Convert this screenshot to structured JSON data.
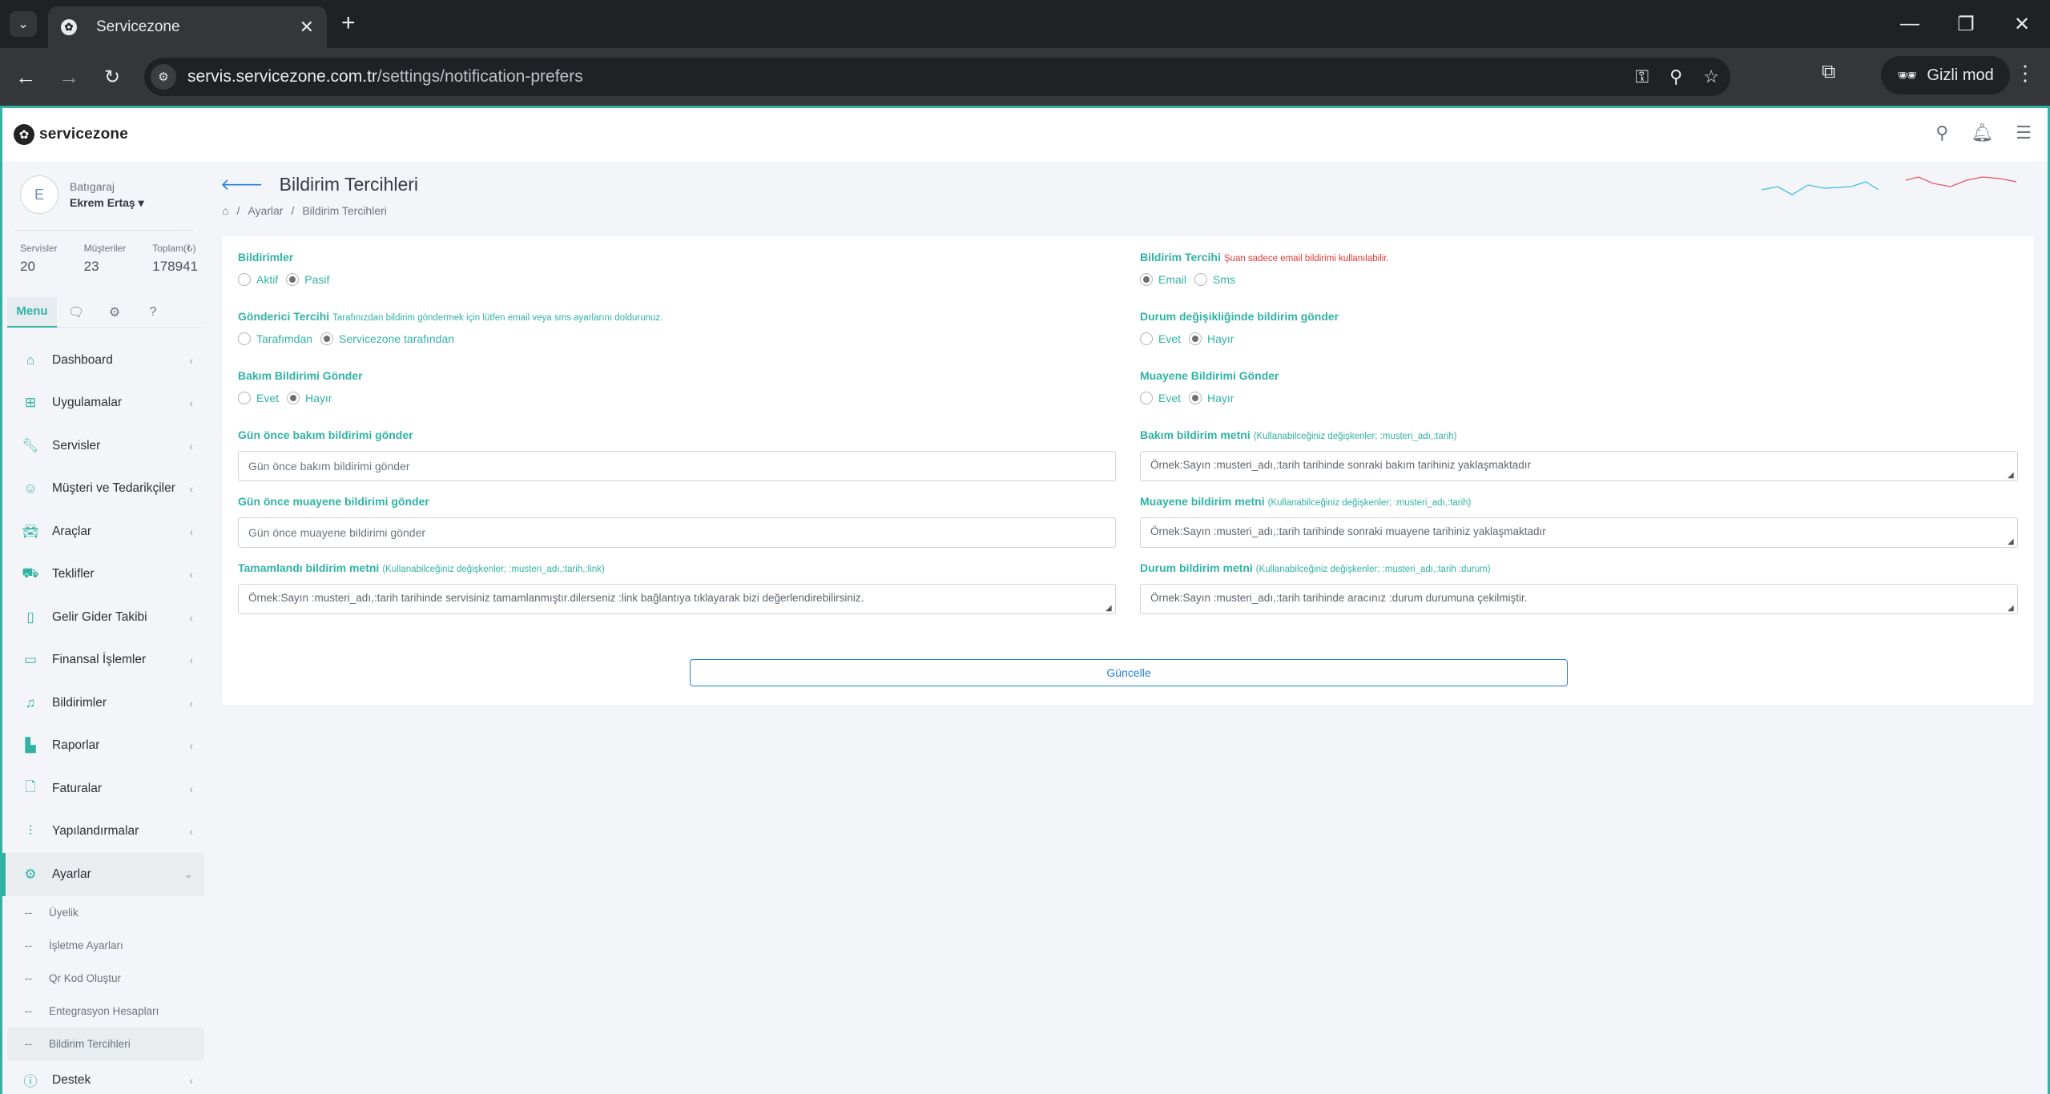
{
  "browser": {
    "tab_title": "Servicezone",
    "url_host": "servis.servicezone.com.tr",
    "url_path": "/settings/notification-prefers",
    "incognito_label": "Gizli mod"
  },
  "app": {
    "logo_text": "servicezone",
    "user": {
      "initial": "E",
      "company": "Batıgaraj",
      "name": "Ekrem Ertaş"
    },
    "stats": [
      {
        "label": "Servisler",
        "value": "20"
      },
      {
        "label": "Müşteriler",
        "value": "23"
      },
      {
        "label": "Toplam(₺)",
        "value": "178941"
      }
    ],
    "side_tab_menu": "Menu",
    "menu": [
      {
        "label": "Dashboard",
        "icon": "home-icon"
      },
      {
        "label": "Uygulamalar",
        "icon": "grid-icon"
      },
      {
        "label": "Servisler",
        "icon": "wrench-icon"
      },
      {
        "label": "Müşteri ve Tedarikçiler",
        "icon": "user-search-icon"
      },
      {
        "label": "Araçlar",
        "icon": "car-icon"
      },
      {
        "label": "Teklifler",
        "icon": "car-service-icon"
      },
      {
        "label": "Gelir Gider Takibi",
        "icon": "book-icon"
      },
      {
        "label": "Finansal İşlemler",
        "icon": "folder-icon"
      },
      {
        "label": "Bildirimler",
        "icon": "bell-icon"
      },
      {
        "label": "Raporlar",
        "icon": "bar-chart-icon"
      },
      {
        "label": "Faturalar",
        "icon": "file-icon"
      },
      {
        "label": "Yapılandırmalar",
        "icon": "sliders-icon"
      },
      {
        "label": "Ayarlar",
        "icon": "gear-icon"
      }
    ],
    "submenu": [
      {
        "label": "Üyelik"
      },
      {
        "label": "İşletme Ayarları"
      },
      {
        "label": "Qr Kod Oluştur"
      },
      {
        "label": "Entegrasyon Hesapları"
      },
      {
        "label": "Bildirim Tercihleri"
      }
    ],
    "menu_last": {
      "label": "Destek",
      "icon": "info-icon"
    },
    "submenu_dash": "--"
  },
  "page": {
    "title": "Bildirim Tercihleri",
    "breadcrumb": [
      "Ayarlar",
      "Bildirim Tercihleri"
    ],
    "breadcrumb_sep": "/"
  },
  "form": {
    "bildirimler": {
      "label": "Bildirimler",
      "options": [
        "Aktif",
        "Pasif"
      ],
      "selected": "Pasif"
    },
    "bildirim_tercihi": {
      "label": "Bildirim Tercihi",
      "note": "Şuan sadece email bildirimi kullanılabilir.",
      "options": [
        "Email",
        "Sms"
      ],
      "selected": "Email"
    },
    "gonderici_tercihi": {
      "label": "Gönderici Tercihi",
      "note": "Tarafınızdan bildirim göndermek için lütfen email veya sms ayarlarını doldurunuz.",
      "options": [
        "Tarafımdan",
        "Servicezone tarafından"
      ],
      "selected": "Servicezone tarafından"
    },
    "durum_degisikliginde": {
      "label": "Durum değişikliğinde bildirim gönder",
      "options": [
        "Evet",
        "Hayır"
      ],
      "selected": "Hayır"
    },
    "bakim_bildirimi": {
      "label": "Bakım Bildirimi Gönder",
      "options": [
        "Evet",
        "Hayır"
      ],
      "selected": "Hayır"
    },
    "muayene_bildirimi": {
      "label": "Muayene Bildirimi Gönder",
      "options": [
        "Evet",
        "Hayır"
      ],
      "selected": "Hayır"
    },
    "gun_once_bakim": {
      "label": "Gün önce bakım bildirimi gönder",
      "placeholder": "Gün önce bakım bildirimi gönder"
    },
    "bakim_metni": {
      "label": "Bakım bildirim metni",
      "note": "(Kullanabilceğiniz değişkenler; :musteri_adı,:tarih)",
      "placeholder": "Örnek:Sayın :musteri_adı,:tarih tarihinde sonraki bakım tarihiniz yaklaşmaktadır"
    },
    "gun_once_muayene": {
      "label": "Gün önce muayene bildirimi gönder",
      "placeholder": "Gün önce muayene bildirimi gönder"
    },
    "muayene_metni": {
      "label": "Muayene bildirim metni",
      "note": "(Kullanabilceğiniz değişkenler; :musteri_adı,:tarih)",
      "placeholder": "Örnek:Sayın :musteri_adı,:tarih tarihinde sonraki muayene tarihiniz yaklaşmaktadır"
    },
    "tamamlandi_metni": {
      "label": "Tamamlandı bildirim metni",
      "note": "(Kullanabilceğiniz değişkenler; :musteri_adı,:tarih,:link)",
      "placeholder": "Örnek:Sayın :musteri_adı,:tarih tarihinde servisiniz tamamlanmıştır.dilerseniz :link bağlantıya tıklayarak bizi değerlendirebilirsiniz."
    },
    "durum_metni": {
      "label": "Durum bildirim metni",
      "note": "(Kullanabilceğiniz değişkenler; :musteri_adı,:tarih :durum)",
      "placeholder": "Örnek:Sayın :musteri_adı,:tarih tarihinde aracınız :durum durumuna çekilmiştir."
    },
    "submit_label": "Güncelle"
  },
  "colors": {
    "accent": "#31b2a4",
    "primary": "#1e7fe0",
    "danger": "#e53935"
  }
}
